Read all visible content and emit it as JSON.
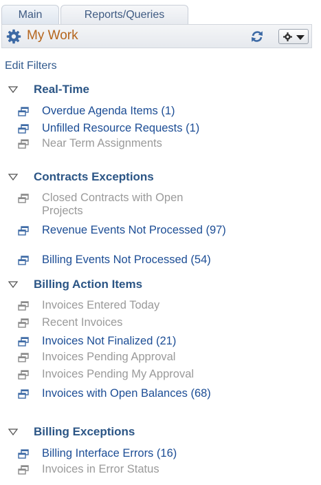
{
  "tabs": [
    {
      "label": "Main",
      "active": true
    },
    {
      "label": "Reports/Queries",
      "active": false
    }
  ],
  "header": {
    "title": "My Work",
    "title_color": "#b5651d"
  },
  "edit_filters_label": "Edit Filters",
  "sections": [
    {
      "label": "Real-Time",
      "items": [
        {
          "label": "Overdue Agenda Items (1)",
          "enabled": true
        },
        {
          "label": "Unfilled Resource Requests (1)",
          "enabled": true
        },
        {
          "label": "Near Term Assignments",
          "enabled": false
        }
      ]
    },
    {
      "label": "Contracts Exceptions",
      "items": [
        {
          "label": "Closed Contracts with Open Projects",
          "enabled": false
        },
        {
          "label": "Revenue Events Not Processed (97)",
          "enabled": true
        },
        {
          "label": "Billing Events Not Processed (54)",
          "enabled": true
        }
      ]
    },
    {
      "label": "Billing Action Items",
      "items": [
        {
          "label": "Invoices Entered Today",
          "enabled": false
        },
        {
          "label": "Recent Invoices",
          "enabled": false
        },
        {
          "label": "Invoices Not Finalized (21)",
          "enabled": true
        },
        {
          "label": "Invoices Pending Approval",
          "enabled": false
        },
        {
          "label": "Invoices Pending My Approval",
          "enabled": false
        },
        {
          "label": "Invoices with Open Balances (68)",
          "enabled": true
        }
      ]
    },
    {
      "label": "Billing Exceptions",
      "items": [
        {
          "label": "Billing Interface Errors (16)",
          "enabled": true
        },
        {
          "label": "Invoices in Error Status",
          "enabled": false
        }
      ]
    }
  ],
  "colors": {
    "link_enabled": "#1c4d95",
    "link_disabled": "#9a9a9a",
    "section_heading": "#2b5585"
  }
}
